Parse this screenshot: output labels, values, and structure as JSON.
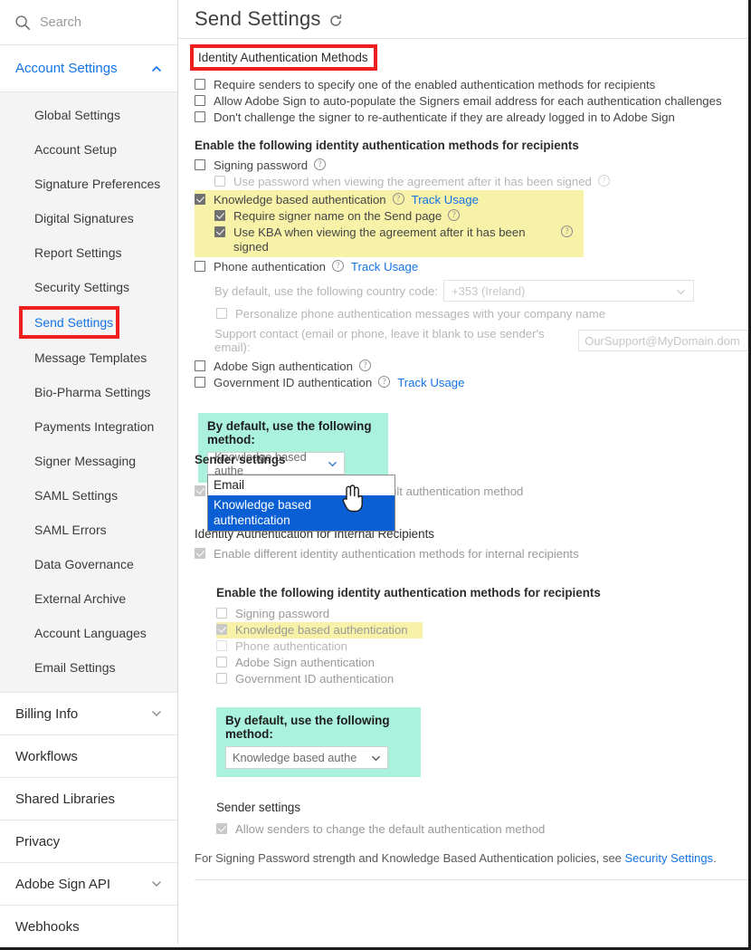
{
  "sidebar": {
    "search": {
      "placeholder": "Search",
      "icon": "search-icon"
    },
    "account_settings": {
      "label": "Account Settings",
      "icon": "chevron-up-icon"
    },
    "sub_items": [
      {
        "label": "Global Settings",
        "active": false
      },
      {
        "label": "Account Setup",
        "active": false
      },
      {
        "label": "Signature Preferences",
        "active": false
      },
      {
        "label": "Digital Signatures",
        "active": false
      },
      {
        "label": "Report Settings",
        "active": false
      },
      {
        "label": "Security Settings",
        "active": false
      },
      {
        "label": "Send Settings",
        "active": true
      },
      {
        "label": "Message Templates",
        "active": false
      },
      {
        "label": "Bio-Pharma Settings",
        "active": false
      },
      {
        "label": "Payments Integration",
        "active": false
      },
      {
        "label": "Signer Messaging",
        "active": false
      },
      {
        "label": "SAML Settings",
        "active": false
      },
      {
        "label": "SAML Errors",
        "active": false
      },
      {
        "label": "Data Governance",
        "active": false
      },
      {
        "label": "External Archive",
        "active": false
      },
      {
        "label": "Account Languages",
        "active": false
      },
      {
        "label": "Email Settings",
        "active": false
      }
    ],
    "groups": [
      {
        "label": "Billing Info",
        "caret": "chevron-down-icon"
      },
      {
        "label": "Workflows",
        "caret": ""
      },
      {
        "label": "Shared Libraries",
        "caret": ""
      },
      {
        "label": "Privacy",
        "caret": ""
      },
      {
        "label": "Adobe Sign API",
        "caret": "chevron-down-icon"
      },
      {
        "label": "Webhooks",
        "caret": ""
      }
    ]
  },
  "main": {
    "page_title": "Send Settings",
    "refresh_icon": "refresh-icon",
    "section_title": "Identity Authentication Methods",
    "top_checkboxes": [
      {
        "label": "Require senders to specify one of the enabled authentication methods for recipients",
        "checked": false
      },
      {
        "label": "Allow Adobe Sign to auto-populate the Signers email address for each authentication challenges",
        "checked": false
      },
      {
        "label": "Don't challenge the signer to re-authenticate if they are already logged in to Adobe Sign",
        "checked": false
      }
    ],
    "enable_methods_heading": "Enable the following identity authentication methods for recipients",
    "signing_password": {
      "label": "Signing password",
      "checked": false
    },
    "signing_password_sub": {
      "label": "Use password when viewing the agreement after it has been signed",
      "checked": false
    },
    "kba": {
      "label": "Knowledge based authentication",
      "checked": true,
      "track_usage": "Track Usage"
    },
    "kba_sub1": {
      "label": "Require signer name on the Send page",
      "checked": true
    },
    "kba_sub2": {
      "label": "Use KBA when viewing the agreement after it has been signed",
      "checked": true
    },
    "phone_auth": {
      "label": "Phone authentication",
      "checked": false,
      "track_usage": "Track Usage"
    },
    "country_code": {
      "label": "By default, use the following country code:",
      "value": "+353 (Ireland)"
    },
    "personalize": {
      "label": "Personalize phone authentication messages with your company name",
      "checked": false
    },
    "support_contact": {
      "label": "Support contact (email or phone, leave it blank to use sender's email):",
      "value": "OurSupport@MyDomain.dom"
    },
    "adobe_sign_auth": {
      "label": "Adobe Sign authentication",
      "checked": false
    },
    "gov_id_auth": {
      "label": "Government ID authentication",
      "checked": false,
      "track_usage": "Track Usage"
    },
    "default_method_block": {
      "label": "By default, use the following method:",
      "selected_value": "Knowledge based authe",
      "options": [
        {
          "label": "Email",
          "selected": false
        },
        {
          "label": "Knowledge based authentication",
          "selected": true
        }
      ]
    },
    "sender_settings_heading": "Sender settings",
    "sender_settings_checkbox": {
      "label": "Allow senders to change the default authentication method",
      "checked": true
    },
    "internal_heading": "Identity Authentication for Internal Recipients",
    "internal_enable": {
      "label": "Enable different identity authentication methods for internal recipients",
      "checked": true
    },
    "internal_methods_heading": "Enable the following identity authentication methods for recipients",
    "internal_methods": [
      {
        "label": "Signing password",
        "checked": false,
        "state": "dim"
      },
      {
        "label": "Knowledge based authentication",
        "checked": true,
        "state": "highlight"
      },
      {
        "label": "Phone authentication",
        "checked": false,
        "state": "disabled"
      },
      {
        "label": "Adobe Sign authentication",
        "checked": false,
        "state": "normal"
      },
      {
        "label": "Government ID authentication",
        "checked": false,
        "state": "normal"
      }
    ],
    "internal_default_block": {
      "label": "By default, use the following method:",
      "selected_value": "Knowledge based authe"
    },
    "internal_sender_heading": "Sender settings",
    "internal_sender_checkbox": {
      "label": "Allow senders to change the default authentication method",
      "checked": true
    },
    "footnote": {
      "text": "For Signing Password strength and Knowledge Based Authentication policies, see ",
      "link": "Security Settings",
      "suffix": "."
    }
  },
  "colors": {
    "accent_blue": "#1473e6",
    "highlight_red": "#f01f1f",
    "highlight_yellow": "#f7f2a8",
    "highlight_teal": "#aaf2dd",
    "dropdown_selected": "#0a5fd4"
  }
}
